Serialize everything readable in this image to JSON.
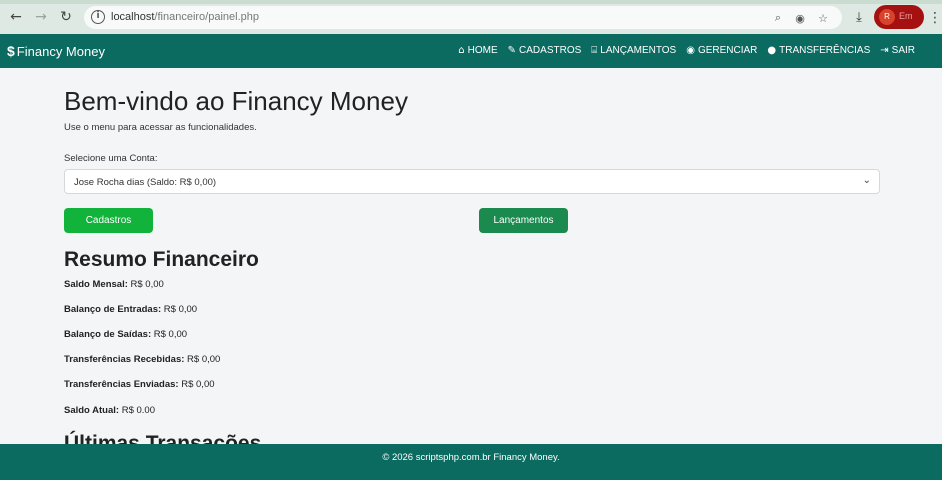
{
  "browser": {
    "url_host": "localhost",
    "url_path": "/financeiro/painel.php",
    "profile_initial": "R",
    "profile_label": "Em"
  },
  "navbar": {
    "brand": "Financy Money",
    "items": [
      {
        "label": "HOME",
        "icon": "home-icon"
      },
      {
        "label": "CADASTROS",
        "icon": "edit-icon"
      },
      {
        "label": "LANÇAMENTOS",
        "icon": "bank-icon"
      },
      {
        "label": "GERENCIAR",
        "icon": "eye-icon"
      },
      {
        "label": "TRANSFERÊNCIAS",
        "icon": "chat-icon"
      },
      {
        "label": "SAIR",
        "icon": "logout-icon"
      }
    ]
  },
  "main": {
    "title": "Bem-vindo ao Financy Money",
    "subtitle": "Use o menu para acessar as funcionalidades.",
    "account_label": "Selecione uma Conta:",
    "account_selected": "Jose Rocha dias (Saldo: R$ 0,00)",
    "btn_cadastros": "Cadastros",
    "btn_lancamentos": "Lançamentos",
    "summary_title": "Resumo Financeiro",
    "summary": [
      {
        "label": "Saldo Mensal:",
        "value": "R$ 0,00"
      },
      {
        "label": "Balanço de Entradas:",
        "value": "R$ 0,00"
      },
      {
        "label": "Balanço de Saídas:",
        "value": "R$ 0,00"
      },
      {
        "label": "Transferências Recebidas:",
        "value": "R$ 0,00"
      },
      {
        "label": "Transferências Enviadas:",
        "value": "R$ 0,00"
      },
      {
        "label": "Saldo Atual:",
        "value": "R$ 0.00"
      }
    ],
    "last_title": "Últimas Transações"
  },
  "footer": {
    "text": "© 2026 scriptsphp.com.br Financy Money."
  },
  "colors": {
    "navbar": "#0c6b61",
    "btn_cadastros": "#11b33a",
    "btn_lancamentos": "#1a8a4f"
  }
}
